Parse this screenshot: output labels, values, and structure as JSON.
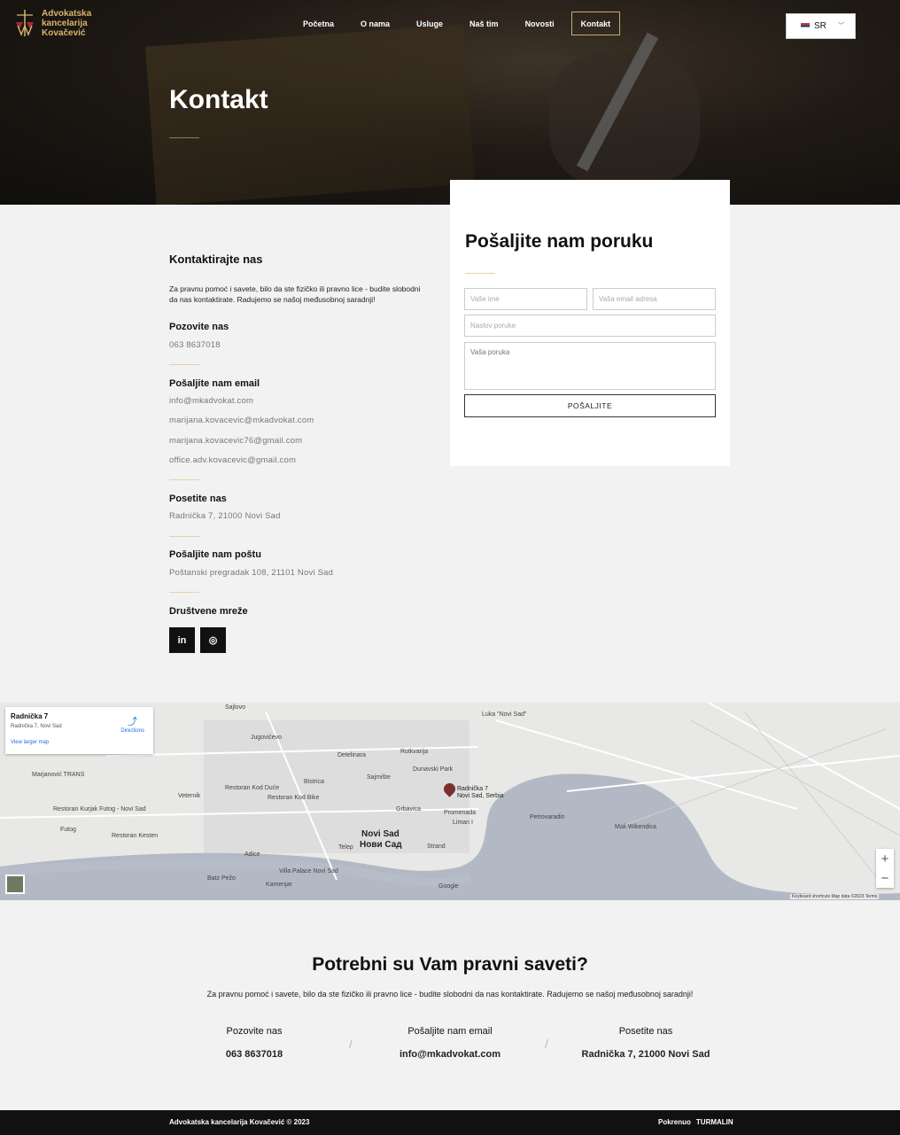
{
  "brand": {
    "line1": "Advokatska",
    "line2": "kancelarija",
    "line3": "Kovačević"
  },
  "nav": {
    "items": [
      "Početna",
      "O nama",
      "Usluge",
      "Naš tim",
      "Novosti",
      "Kontakt"
    ],
    "active": "Kontakt"
  },
  "lang": {
    "selected": "SR",
    "icon": "serbia-flag-icon"
  },
  "hero": {
    "title": "Kontakt"
  },
  "info": {
    "heading": "Kontaktirajte nas",
    "desc": "Za pravnu pomoć i savete, bilo da ste fizičko ili pravno lice - budite slobodni da nas kontaktirate. Radujemo se našoj međusobnoj saradnji!",
    "call_label": "Pozovite nas",
    "phone": "063 8637018",
    "email_label": "Pošaljite nam email",
    "emails": [
      "info@mkadvokat.com",
      "marijana.kovacevic@mkadvokat.com",
      "marijana.kovacevic76@gmail.com",
      "office.adv.kovacevic@gmail.com"
    ],
    "visit_label": "Posetite nas",
    "address": "Radnička 7, 21000 Novi Sad",
    "mail_label": "Pošaljite nam poštu",
    "po_box": "Poštanski pregradak 108, 21101 Novi Sad",
    "social_label": "Društvene mreže",
    "social": [
      {
        "glyph": "in",
        "icon": "linkedin-icon"
      },
      {
        "glyph": "◎",
        "icon": "instagram-icon"
      }
    ]
  },
  "form": {
    "title": "Pošaljite nam poruku",
    "name_placeholder": "Vaše ime",
    "email_placeholder": "Vaša email adresa",
    "subject_placeholder": "Naslov poruke",
    "message_placeholder": "Vaša poruka",
    "submit": "POŠALJITE"
  },
  "map": {
    "card_title": "Radnička 7",
    "card_address": "Radnička 7, Novi Sad",
    "card_link": "View larger map",
    "directions": "Directions",
    "city": "Novi Sad",
    "city_cyr": "Нови Сад",
    "pin_label": "Radnička 7",
    "pin_sub": "Novi Sad, Serbia",
    "labels": [
      "Sajlovo",
      "Jugovićevo",
      "Detelinara",
      "Rotkvarija",
      "Bistrica",
      "Sajmište",
      "Grbavica",
      "Liman I",
      "Petrovaradin",
      "Adice",
      "Telep",
      "Futog",
      "Veternik",
      "Kamenjar",
      "Promenada",
      "Strand",
      "Dunavski Park",
      "Luka \"Novi Sad\"",
      "Mali Wikendica",
      "Villa Palace Novi Sad",
      "Restoran Kod Duće",
      "Restoran Kod Bike",
      "Restoran Kurjak Futog - Novi Sad",
      "Restoran Kesten",
      "Marjanović TRANS",
      "Batz Pežo",
      "Google"
    ],
    "zoom_in": "+",
    "zoom_out": "−",
    "footer": "Keyboard shortcuts   Map data ©2023   Terms"
  },
  "cta": {
    "title": "Potrebni su Vam pravni saveti?",
    "desc": "Za pravnu pomoć i savete, bilo da ste fizičko ili pravno lice - budite slobodni da nas kontaktirate. Radujemo se našoj međusobnoj saradnji!",
    "cols": [
      {
        "label": "Pozovite nas",
        "value": "063 8637018"
      },
      {
        "label": "Pošaljite nam email",
        "value": "info@mkadvokat.com"
      },
      {
        "label": "Posetite nas",
        "value": "Radnička 7, 21000 Novi Sad"
      }
    ]
  },
  "footer": {
    "copyright": "Advokatska kancelarija Kovačević © 2023",
    "powered_label": "Pokrenuo",
    "powered_by": "TURMALIN"
  }
}
